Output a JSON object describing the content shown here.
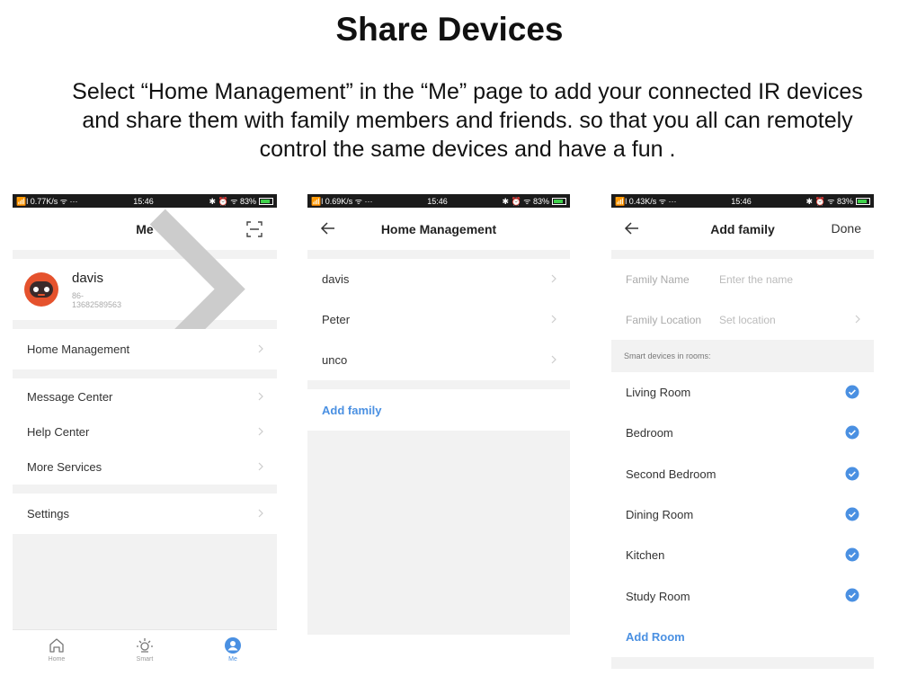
{
  "heading": "Share Devices",
  "description": {
    "line1": "Select “Home Management” in the “Me” page to add your connected IR devices",
    "line2": "and share them with family members and friends. so that you all can remotely",
    "line3": "control the same devices and have a fun ."
  },
  "colors": {
    "accent": "#4a90e2",
    "page_bg": "#f2f2f2",
    "status_bar": "#1b1b1b",
    "avatar": "#e5522d"
  },
  "phone_me": {
    "status": {
      "left": "📶l 0.77K/s ᯤ ···",
      "time": "15:46",
      "right": "✱ ⏰ ᯤ 83%"
    },
    "title": "Me",
    "scan_icon": "scan-icon",
    "profile": {
      "name": "davis",
      "phone": "86-13682589563"
    },
    "menu": {
      "home_management": "Home Management",
      "message_center": "Message Center",
      "help_center": "Help Center",
      "more_services": "More Services",
      "settings": "Settings"
    },
    "tabs": [
      {
        "label": "Home",
        "icon": "home-icon"
      },
      {
        "label": "Smart",
        "icon": "sun-icon"
      },
      {
        "label": "Me",
        "icon": "person-icon"
      }
    ]
  },
  "phone_home": {
    "status": {
      "left": "📶l 0.69K/s ᯤ ···",
      "time": "15:46",
      "right": "✱ ⏰ ᯤ 83%"
    },
    "title": "Home Management",
    "families": [
      "davis",
      "Peter",
      "unco"
    ],
    "add_family": "Add family"
  },
  "phone_add": {
    "status": {
      "left": "📶l 0.43K/s ᯤ ···",
      "time": "15:46",
      "right": "✱ ⏰ ᯤ 83%"
    },
    "title": "Add family",
    "done": "Done",
    "family_name": {
      "label": "Family Name",
      "placeholder": "Enter the name"
    },
    "family_location": {
      "label": "Family Location",
      "value": "Set location"
    },
    "rooms_section": "Smart devices in rooms:",
    "rooms": [
      "Living Room",
      "Bedroom",
      "Second Bedroom",
      "Dining Room",
      "Kitchen",
      "Study Room"
    ],
    "add_room": "Add Room"
  }
}
